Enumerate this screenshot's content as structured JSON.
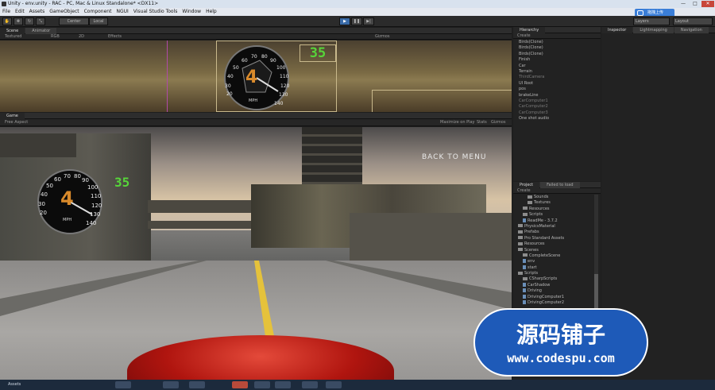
{
  "window": {
    "title": "Unity - env.unity - RAC - PC, Mac & Linux Standalone* <DX11>",
    "min": "—",
    "max": "□",
    "close": "✕"
  },
  "menu": [
    "File",
    "Edit",
    "Assets",
    "GameObject",
    "Component",
    "NGUI",
    "Visual Studio Tools",
    "Window",
    "Help"
  ],
  "ime_badge": "拖拽上传",
  "toolbar": {
    "center_label": "Center",
    "local_label": "Local",
    "layers_label": "Layers",
    "layout_label": "Layout"
  },
  "scene_panel": {
    "tabs": [
      "Scene",
      "Animator"
    ],
    "shading": "Textured",
    "color_mode": "RGB",
    "mode_2d": "2D",
    "effects": "Effects",
    "gizmos": "Gizmos"
  },
  "game_panel": {
    "tab": "Game",
    "aspect": "Free Aspect",
    "maximize": "Maximize on Play",
    "stats": "Stats",
    "gizmos": "Gizmos"
  },
  "hud": {
    "digital_speed": "35",
    "gear": "4",
    "unit": "MPH",
    "back_to_menu": "BACK TO MENU",
    "gauge_ticks": [
      "20",
      "30",
      "40",
      "50",
      "60",
      "70",
      "80",
      "90",
      "100",
      "110",
      "120",
      "130",
      "140"
    ]
  },
  "hierarchy": {
    "tab": "Hierarchy",
    "create": "Create",
    "items": [
      {
        "label": "Birds(Clone)",
        "dim": false
      },
      {
        "label": "Birds(Clone)",
        "dim": false
      },
      {
        "label": "Birds(Clone)",
        "dim": false
      },
      {
        "label": "Finish",
        "dim": false
      },
      {
        "label": "Car",
        "dim": false
      },
      {
        "label": "Terrain",
        "dim": false
      },
      {
        "label": "ThirdCamera",
        "dim": true
      },
      {
        "label": "UI Root",
        "dim": false
      },
      {
        "label": "pos",
        "dim": false
      },
      {
        "label": "brakeLine",
        "dim": false
      },
      {
        "label": "CarComputer1",
        "dim": true
      },
      {
        "label": "CarComputer2",
        "dim": true
      },
      {
        "label": "CarComputer3",
        "dim": true
      },
      {
        "label": "One shot audio",
        "dim": false
      }
    ]
  },
  "inspector": {
    "tabs": [
      "Inspector",
      "Lightmapping",
      "Navigation"
    ]
  },
  "project": {
    "tabs": [
      "Project",
      "Failed to load"
    ],
    "create": "Create",
    "items": [
      {
        "label": "Sounds",
        "indent": 2,
        "kind": "folder"
      },
      {
        "label": "Textures",
        "indent": 2,
        "kind": "folder"
      },
      {
        "label": "Resources",
        "indent": 1,
        "kind": "folder"
      },
      {
        "label": "Scripts",
        "indent": 1,
        "kind": "folder"
      },
      {
        "label": "ReadMe - 3.7.2",
        "indent": 1,
        "kind": "file"
      },
      {
        "label": "PhysicsMaterial",
        "indent": 0,
        "kind": "folder"
      },
      {
        "label": "Prefabs",
        "indent": 0,
        "kind": "folder"
      },
      {
        "label": "Pro Standard Assets",
        "indent": 0,
        "kind": "folder"
      },
      {
        "label": "Resources",
        "indent": 0,
        "kind": "folder"
      },
      {
        "label": "Scenes",
        "indent": 0,
        "kind": "folder"
      },
      {
        "label": "CompleteScene",
        "indent": 1,
        "kind": "folder"
      },
      {
        "label": "env",
        "indent": 1,
        "kind": "file"
      },
      {
        "label": "start",
        "indent": 1,
        "kind": "file"
      },
      {
        "label": "Scripts",
        "indent": 0,
        "kind": "folder"
      },
      {
        "label": "CSharpScripts",
        "indent": 1,
        "kind": "folder"
      },
      {
        "label": "CarShadow",
        "indent": 1,
        "kind": "file"
      },
      {
        "label": "Driving",
        "indent": 1,
        "kind": "file"
      },
      {
        "label": "DrivingComputer1",
        "indent": 1,
        "kind": "file"
      },
      {
        "label": "DrivingComputer2",
        "indent": 1,
        "kind": "file"
      }
    ]
  },
  "statusbar": {
    "label": "Assets"
  },
  "watermark": {
    "cn": "源码铺子",
    "url": "www.codespu.com"
  },
  "colors": {
    "unity_dark": "#2b2b2b",
    "play_blue": "#3a6ba8",
    "digital_green": "#57d43a",
    "watermark_blue": "#1e5ab8"
  }
}
